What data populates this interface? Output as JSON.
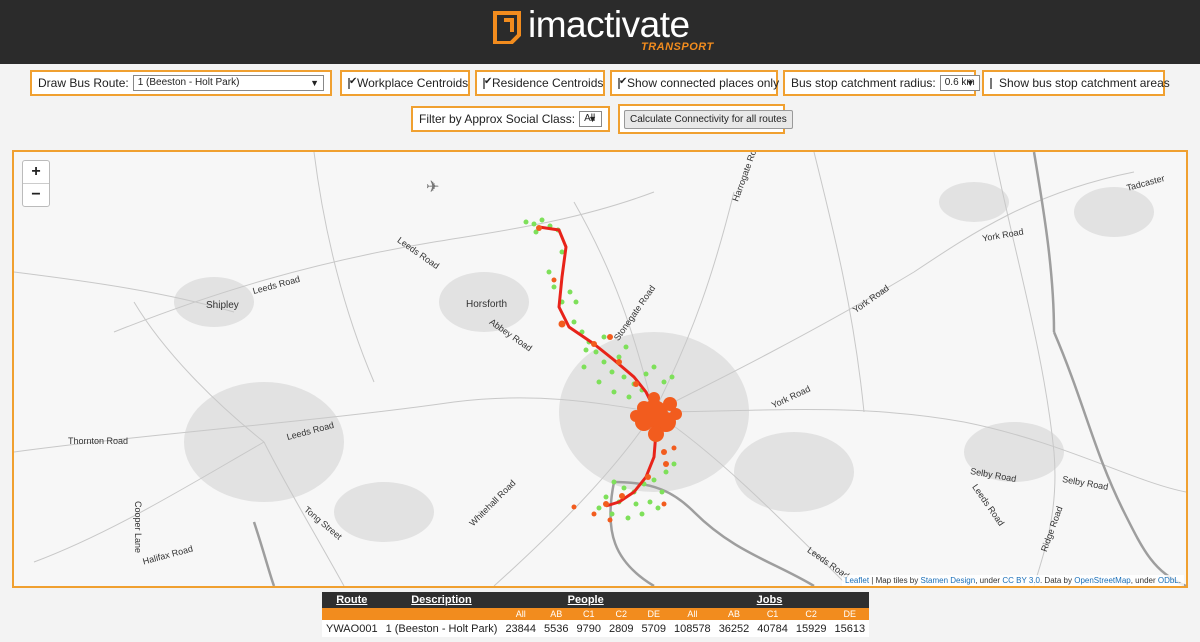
{
  "header": {
    "logo_text": "imactivate",
    "logo_sub": "TRANSPORT"
  },
  "controls": {
    "draw_bus_route_label": "Draw Bus Route:",
    "draw_bus_route_value": "1 (Beeston - Holt Park)",
    "workplace_label": "Workplace Centroids",
    "workplace_checked": true,
    "residence_label": "Residence Centroids",
    "residence_checked": true,
    "connected_label": "Show connected places only",
    "connected_checked": true,
    "catchment_radius_label": "Bus stop catchment radius:",
    "catchment_radius_value": "0.6 km",
    "show_catchment_label": "Show bus stop catchment areas",
    "show_catchment_checked": false,
    "social_class_label": "Filter by Approx Social Class:",
    "social_class_value": "All",
    "calculate_button": "Calculate Connectivity for all routes"
  },
  "map": {
    "zoom_in": "+",
    "zoom_out": "−",
    "places": [
      "Shipley",
      "Horsforth",
      "Leeds Road",
      "Leeds Road",
      "Abbey Road",
      "Stonegate Road",
      "Harrogate Road",
      "York Road",
      "York Road",
      "York Road",
      "Tadcaster",
      "Thornton Road",
      "Leeds Road",
      "Tong Street",
      "Whitehall Road",
      "Halifax Road",
      "Cooper Lane",
      "Selby Road",
      "Selby Road",
      "Leeds Road",
      "Ridge Road",
      "Leeds Road"
    ],
    "attribution": {
      "leaflet": "Leaflet",
      "text1": " | Map tiles by ",
      "stamen": "Stamen Design",
      "text2": ", under ",
      "ccby": "CC BY 3.0",
      "text3": ". Data by ",
      "osm": "OpenStreetMap",
      "text4": ", under ",
      "odbl": "ODbL",
      "text5": "."
    },
    "colors": {
      "route": "#e8231a",
      "residence": "#7ee05a",
      "workplace": "#f25c1e"
    }
  },
  "table": {
    "headers": [
      "Route",
      "Description",
      "People",
      "Jobs"
    ],
    "subheaders": [
      "All",
      "AB",
      "C1",
      "C2",
      "DE",
      "All",
      "AB",
      "C1",
      "C2",
      "DE"
    ],
    "row": [
      "YWAO001",
      "1 (Beeston - Holt Park)",
      "23844",
      "5536",
      "9790",
      "2809",
      "5709",
      "108578",
      "36252",
      "40784",
      "15929",
      "15613"
    ]
  }
}
